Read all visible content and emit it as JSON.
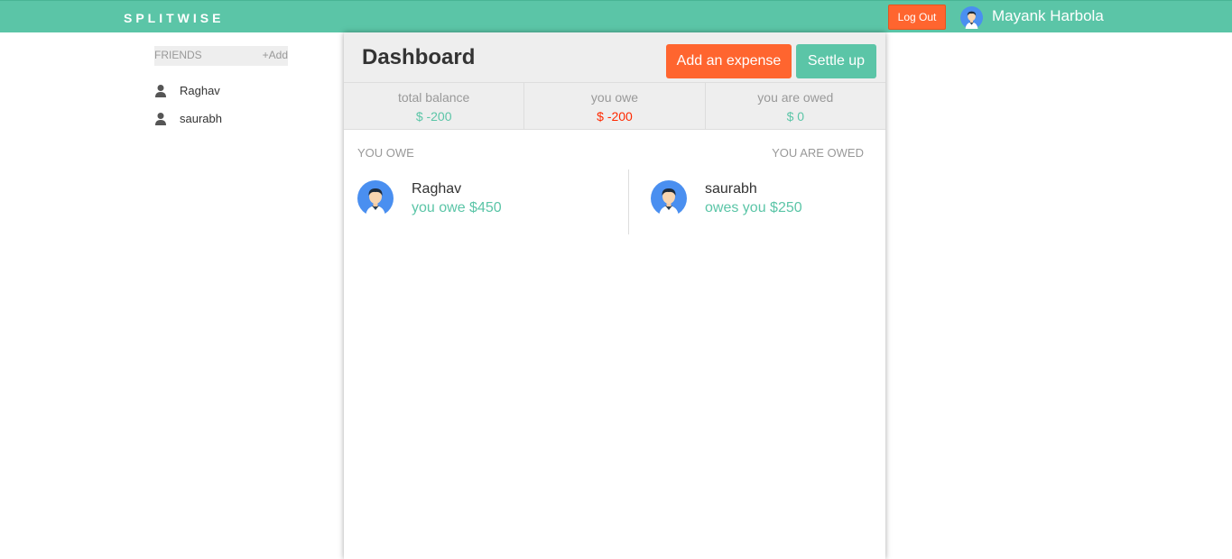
{
  "header": {
    "brand": "SPLITWISE",
    "logout_label": "Log Out",
    "user_name": "Mayank Harbola"
  },
  "sidebar": {
    "title": "FRIENDS",
    "add_label": "+Add",
    "friends": [
      {
        "name": "Raghav",
        "icon": "person-icon"
      },
      {
        "name": "saurabh",
        "icon": "person-icon"
      }
    ]
  },
  "dashboard": {
    "title": "Dashboard",
    "add_expense_label": "Add an expense",
    "settle_up_label": "Settle up",
    "balances": [
      {
        "label": "total balance",
        "value": "$ -200",
        "color": "#5bc5a7"
      },
      {
        "label": "you owe",
        "value": "$ -200",
        "color": "#ff2900"
      },
      {
        "label": "you are owed",
        "value": "$ 0",
        "color": "#5bc5a7"
      }
    ],
    "you_owe_heading": "YOU OWE",
    "you_are_owed_heading": "YOU ARE OWED",
    "you_owe": [
      {
        "name": "Raghav",
        "detail": "you owe $450"
      }
    ],
    "you_are_owed": [
      {
        "name": "saurabh",
        "detail": "owes you $250"
      }
    ]
  },
  "colors": {
    "brand": "#5bc5a7",
    "accent": "#ff652f",
    "negative": "#ff2900"
  }
}
